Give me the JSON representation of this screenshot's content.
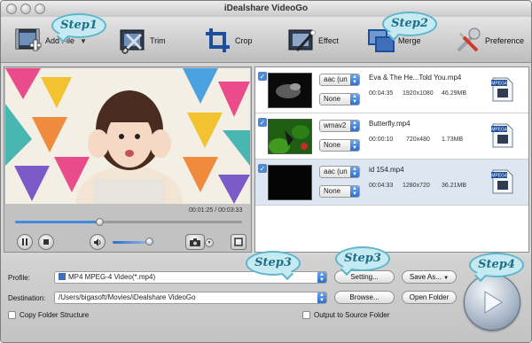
{
  "app": {
    "title": "iDealshare VideoGo"
  },
  "toolbar": {
    "add_file": "Add File",
    "trim": "Trim",
    "crop": "Crop",
    "effect": "Effect",
    "merge": "Merge",
    "preference": "Preference"
  },
  "steps": {
    "s1": "Step1",
    "s2": "Step2",
    "s3a": "Step3",
    "s3b": "Step3",
    "s4": "Step4"
  },
  "player": {
    "time": "00:01:25 / 00:03:33",
    "progress": 0.37,
    "volume": 0.85
  },
  "files": [
    {
      "name": "Eva & The He...Told You.mp4",
      "audio": "aac (un",
      "subtitle": "None",
      "duration": "00:04:35",
      "resolution": "1920x1080",
      "size": "46.29MB",
      "checked": true,
      "selected": false,
      "badge": "MPEG4"
    },
    {
      "name": "Butterfly.mp4",
      "audio": "wmav2",
      "subtitle": "None",
      "duration": "00:00:10",
      "resolution": "720x480",
      "size": "1.73MB",
      "checked": true,
      "selected": false,
      "badge": "MPEG4"
    },
    {
      "name": "id 154.mp4",
      "audio": "aac (un",
      "subtitle": "None",
      "duration": "00:04:33",
      "resolution": "1280x720",
      "size": "36.21MB",
      "checked": true,
      "selected": true,
      "badge": "MPEG4"
    }
  ],
  "bottom": {
    "profile_label": "Profile:",
    "profile_value": "MP4 MPEG-4 Video(*.mp4)",
    "destination_label": "Destination:",
    "destination_value": "/Users/bigasoft/Movies/iDealshare VideoGo",
    "settings_button": "Setting...",
    "browse_button": "Browse...",
    "save_as_button": "Save As...",
    "open_folder_button": "Open Folder",
    "copy_folder_structure": "Copy Folder Structure",
    "output_to_source": "Output to Source Folder"
  },
  "colors": {
    "accent": "#3e8be0",
    "step_fill": "#c6eaf2",
    "step_border": "#5eb5cc",
    "step_text": "#1d6e86"
  }
}
